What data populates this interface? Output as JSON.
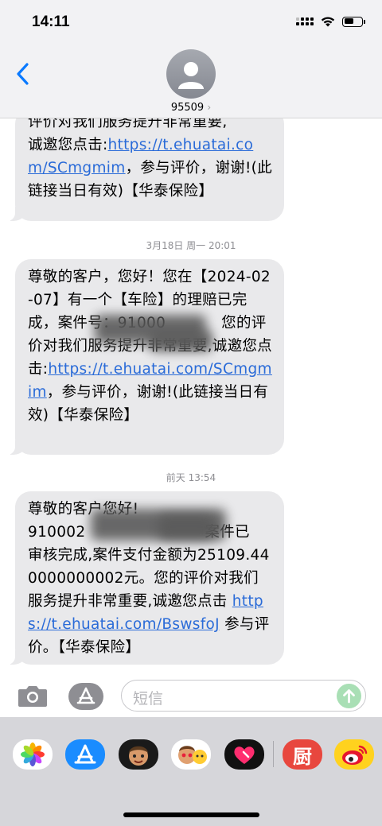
{
  "status_bar": {
    "time": "14:11"
  },
  "header": {
    "contact_name": "95509",
    "chevron": "›"
  },
  "messages": [
    {
      "lines": [
        "评价对我们服务提升非常重要,",
        "诚邀您点击:"
      ],
      "link": "https://t.ehuatai.com/SCmgmim",
      "tail": "，参与评价，谢谢!(此链接当日有效)【华泰保险】"
    },
    {
      "timestamp": "3月18日 周一 20:01",
      "pre": "尊敬的客户，您好！您在【2024-02-07】有一个【车险】的理赔已完成，案件号：91000",
      "mid": "您的评价对我们服务提升非常重要,诚邀您点击:",
      "link": "https://t.ehuatai.com/SCmgmim",
      "tail": "，参与评价，谢谢!(此链接当日有效)【华泰保险】"
    },
    {
      "timestamp": "前天 13:54",
      "pre": "尊敬的客户您好!",
      "line2a": "910002",
      "line2b": "案件已",
      "body": "审核完成,案件支付金额为25109.440000000002元。您的评价对我们服务提升非常重要,诚邀您点击 ",
      "link": "https://t.ehuatai.com/BswsfoJ",
      "tail": " 参与评价。【华泰保险】"
    }
  ],
  "input": {
    "placeholder": "短信"
  },
  "drawer": {
    "apps": [
      "photos",
      "app-store",
      "memoji",
      "animoji",
      "digital-touch",
      "xiachufang",
      "weibo"
    ],
    "xiachufang_glyph": "厨"
  },
  "colors": {
    "bubble": "#e9e9eb",
    "link": "#2a6bd8",
    "accent": "#0a7aff",
    "send": "#a9dfb5"
  }
}
